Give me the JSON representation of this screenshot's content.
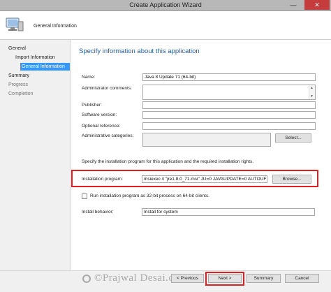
{
  "window": {
    "title": "Create Application Wizard",
    "minimize_glyph": "—",
    "close_glyph": "✕"
  },
  "header": {
    "text": "General Information",
    "icon": "computer-icon"
  },
  "nav": {
    "items": [
      {
        "label": "General"
      },
      {
        "label": "Import Information"
      },
      {
        "label": "General Information"
      },
      {
        "label": "Summary"
      },
      {
        "label": "Progress"
      },
      {
        "label": "Completion"
      }
    ]
  },
  "content": {
    "heading": "Specify information about this application",
    "fields": {
      "name": {
        "label": "Name:",
        "value": "Java 8 Update 71 (64-bit)"
      },
      "admin_comments": {
        "label": "Administrator comments:",
        "value": ""
      },
      "publisher": {
        "label": "Publisher:",
        "value": ""
      },
      "software_version": {
        "label": "Software version:",
        "value": ""
      },
      "optional_reference": {
        "label": "Optional reference:",
        "value": ""
      },
      "admin_categories": {
        "label": "Administrative categories:",
        "value": ""
      }
    },
    "select_button": "Select...",
    "install_note": "Specify the installation program for this application and the required installation rights.",
    "install_program": {
      "label": "Installation program:",
      "value": "msiexec /i \"jre1.8.0_71.msi\" JU=0 JAVAUPDATE=0 AUTOUF"
    },
    "browse_button": "Browse...",
    "checkbox_32bit": "Run installation program as 32-bit process on 64-bit clients.",
    "install_behavior": {
      "label": "Install behavior:",
      "value": "Install for system"
    }
  },
  "footer": {
    "previous": "< Previous",
    "next": "Next >",
    "summary": "Summary",
    "cancel": "Cancel",
    "watermark": "©Prajwal Desai.com"
  },
  "colors": {
    "accent": "#1e5aa8",
    "selection": "#3399ff",
    "highlight": "#e02020"
  }
}
